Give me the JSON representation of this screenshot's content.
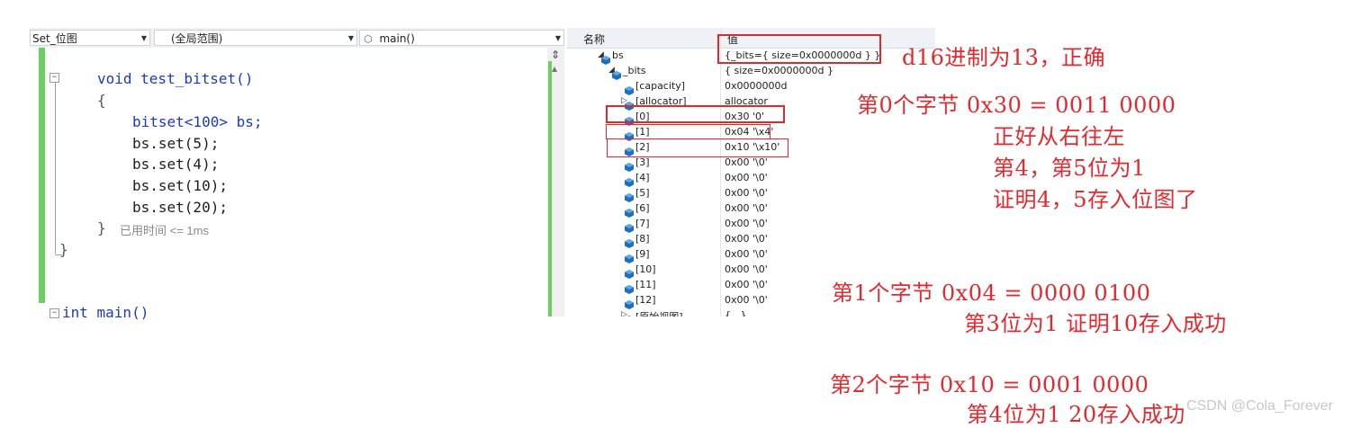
{
  "toolbar": {
    "project_combo": "Set_位图",
    "scope_combo": "(全局范围)",
    "function_combo": "main()"
  },
  "editor": {
    "lines": {
      "func_sig": "void test_bitset()",
      "open_brace": "{",
      "decl": "bitset<100> bs;",
      "set5": "bs.set(5);",
      "set4": "bs.set(4);",
      "set10": "bs.set(10);",
      "set20": "bs.set(20);",
      "close_brace": "}",
      "elapsed": "已用时间 <= 1ms",
      "outer_close": "}",
      "main_sig": "int main()"
    }
  },
  "watch": {
    "col_name": "名称",
    "col_value": "值",
    "rows": [
      {
        "name": "bs",
        "value": "{_bits={ size=0x0000000d } }"
      },
      {
        "name": "_bits",
        "value": "{ size=0x0000000d }"
      },
      {
        "name": "[capacity]",
        "value": "0x0000000d"
      },
      {
        "name": "[allocator]",
        "value": "allocator"
      },
      {
        "name": "[0]",
        "value": "0x30 '0'"
      },
      {
        "name": "[1]",
        "value": "0x04 '\\x4'"
      },
      {
        "name": "[2]",
        "value": "0x10 '\\x10'"
      },
      {
        "name": "[3]",
        "value": "0x00 '\\0'"
      },
      {
        "name": "[4]",
        "value": "0x00 '\\0'"
      },
      {
        "name": "[5]",
        "value": "0x00 '\\0'"
      },
      {
        "name": "[6]",
        "value": "0x00 '\\0'"
      },
      {
        "name": "[7]",
        "value": "0x00 '\\0'"
      },
      {
        "name": "[8]",
        "value": "0x00 '\\0'"
      },
      {
        "name": "[9]",
        "value": "0x00 '\\0'"
      },
      {
        "name": "[10]",
        "value": "0x00 '\\0'"
      },
      {
        "name": "[11]",
        "value": "0x00 '\\0'"
      },
      {
        "name": "[12]",
        "value": "0x00 '\\0'"
      },
      {
        "name": "[原始视图]",
        "value": "{...}"
      }
    ]
  },
  "annotations": {
    "d16": "d16进制为13，正确",
    "byte0_title": "第0个字节  0x30 = 0011 0000",
    "byte0_l1": "正好从右往左",
    "byte0_l2": "第4，第5位为1",
    "byte0_l3": "证明4，5存入位图了",
    "byte1_title": "第1个字节  0x04 = 0000 0100",
    "byte1_l1": "第3位为1    证明10存入成功",
    "byte2_title": "第2个字节  0x10 = 0001 0000",
    "byte2_l1": "第4位为1    20存入成功"
  },
  "watermark": "CSDN @Cola_Forever",
  "colors": {
    "annotation_red": "#e5282d",
    "keyword_blue": "#1a39c6",
    "gutter_green": "#6ad060"
  }
}
